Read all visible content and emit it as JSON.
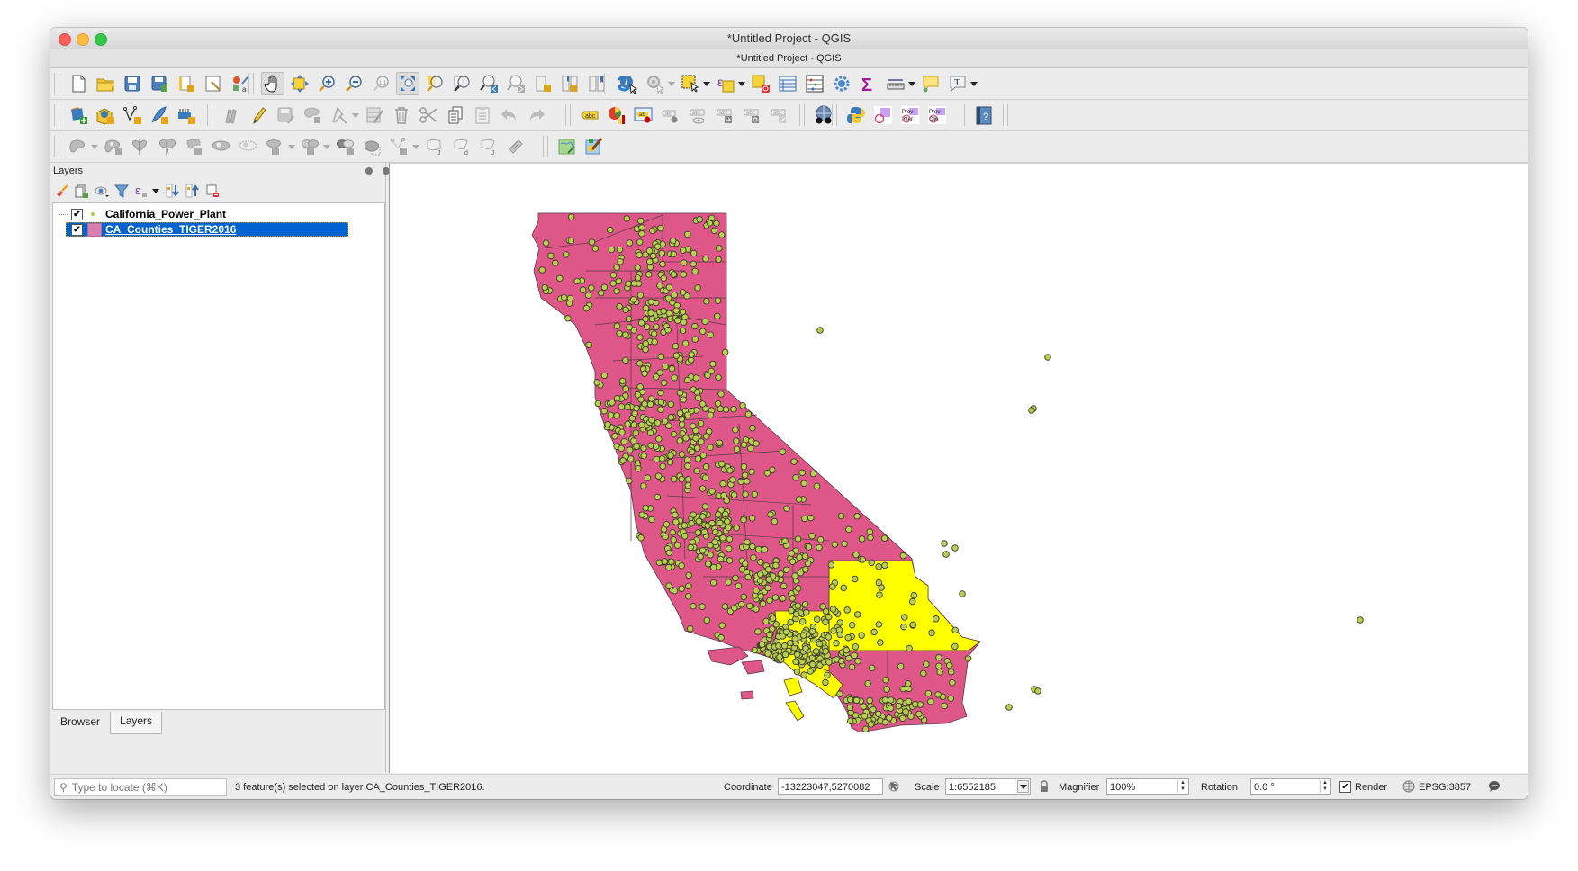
{
  "window": {
    "title": "*Untitled Project - QGIS",
    "subtitle": "*Untitled Project - QGIS"
  },
  "toolbars": {
    "row1": [
      {
        "name": "new-project",
        "icon": "new-file-icon"
      },
      {
        "name": "open-project",
        "icon": "folder-icon"
      },
      {
        "name": "save-project",
        "icon": "save-icon"
      },
      {
        "name": "save-as",
        "icon": "save-as-icon"
      },
      {
        "name": "new-print-layout",
        "icon": "print-layout-icon"
      },
      {
        "name": "layout-manager",
        "icon": "layout-manager-icon"
      },
      {
        "name": "style-manager",
        "icon": "style-manager-icon"
      },
      {
        "name": "pan-map",
        "icon": "hand-icon",
        "active": true
      },
      {
        "name": "pan-to-selection",
        "icon": "pan-selection-icon"
      },
      {
        "name": "zoom-in",
        "icon": "zoom-in-icon"
      },
      {
        "name": "zoom-out",
        "icon": "zoom-out-icon"
      },
      {
        "name": "zoom-native",
        "icon": "zoom-1-1-icon"
      },
      {
        "name": "zoom-full",
        "icon": "zoom-full-icon"
      },
      {
        "name": "zoom-to-selection",
        "icon": "zoom-selection-icon"
      },
      {
        "name": "zoom-to-layer",
        "icon": "zoom-layer-icon"
      },
      {
        "name": "zoom-last",
        "icon": "zoom-last-icon"
      },
      {
        "name": "zoom-next",
        "icon": "zoom-next-icon"
      },
      {
        "name": "new-bookmark",
        "icon": "new-bookmark-icon"
      },
      {
        "name": "show-bookmarks",
        "icon": "bookmarks-icon"
      },
      {
        "name": "spatial-bookmarks",
        "icon": "bookmark-icon"
      },
      {
        "name": "refresh",
        "icon": "refresh-icon"
      },
      {
        "name": "identify",
        "icon": "identify-icon"
      },
      {
        "name": "run-action",
        "icon": "action-icon"
      },
      {
        "name": "select-features",
        "icon": "select-icon"
      },
      {
        "name": "select-by-expression",
        "icon": "expression-select-icon"
      },
      {
        "name": "deselect-all",
        "icon": "deselect-icon"
      },
      {
        "name": "attribute-table",
        "icon": "table-icon"
      },
      {
        "name": "field-calculator",
        "icon": "abacus-icon"
      },
      {
        "name": "processing-toolbox",
        "icon": "gear-icon"
      },
      {
        "name": "statistical-summary",
        "icon": "sigma-icon"
      },
      {
        "name": "measure-line",
        "icon": "ruler-icon"
      },
      {
        "name": "map-tips",
        "icon": "speech-bubble-icon"
      },
      {
        "name": "text-annotation",
        "icon": "text-annotation-icon"
      }
    ],
    "row2": [
      {
        "name": "data-source-manager",
        "icon": "add-layer-icon"
      },
      {
        "name": "new-geopackage-layer",
        "icon": "geopackage-icon"
      },
      {
        "name": "new-shapefile-layer",
        "icon": "shapefile-icon"
      },
      {
        "name": "new-spatialite-layer",
        "icon": "feather-icon"
      },
      {
        "name": "new-virtual-layer",
        "icon": "virtual-layer-icon"
      },
      {
        "name": "current-edits",
        "icon": "edits-icon"
      },
      {
        "name": "toggle-editing",
        "icon": "pencil-icon"
      },
      {
        "name": "save-layer-edits",
        "icon": "save-edits-icon"
      },
      {
        "name": "add-feature",
        "icon": "add-polygon-icon"
      },
      {
        "name": "vertex-tool",
        "icon": "vertex-tool-icon"
      },
      {
        "name": "modify-attributes",
        "icon": "modify-attributes-icon"
      },
      {
        "name": "delete-selected",
        "icon": "trash-icon"
      },
      {
        "name": "cut-features",
        "icon": "scissors-icon"
      },
      {
        "name": "copy-features",
        "icon": "copy-icon"
      },
      {
        "name": "paste-features",
        "icon": "paste-icon"
      },
      {
        "name": "undo",
        "icon": "undo-icon"
      },
      {
        "name": "redo",
        "icon": "redo-icon"
      },
      {
        "name": "layer-labeling",
        "icon": "label-icon"
      },
      {
        "name": "layer-diagram",
        "icon": "diagram-icon"
      },
      {
        "name": "pin-labels",
        "icon": "pin-label-icon"
      },
      {
        "name": "highlight-pinned",
        "icon": "highlight-label-icon"
      },
      {
        "name": "show-hide-labels",
        "icon": "show-label-icon"
      },
      {
        "name": "move-label",
        "icon": "move-label-icon"
      },
      {
        "name": "rotate-label",
        "icon": "rotate-label-icon"
      },
      {
        "name": "change-label",
        "icon": "change-label-icon"
      },
      {
        "name": "geocoding",
        "icon": "globe-binoculars-icon"
      },
      {
        "name": "python-console",
        "icon": "python-icon"
      },
      {
        "name": "plugin-a",
        "icon": "plugin-shape-icon"
      },
      {
        "name": "prev-inter",
        "icon": "prev-inter-icon",
        "label": "Prev Inter"
      },
      {
        "name": "prev-clip",
        "icon": "prev-clip-icon",
        "label": "Prev Clip"
      },
      {
        "name": "help",
        "icon": "help-book-icon"
      }
    ],
    "row3": [
      {
        "name": "digitize-shape",
        "icon": "shape-icon"
      },
      {
        "name": "add-ring",
        "icon": "ring-icon"
      },
      {
        "name": "split-features",
        "icon": "split-icon"
      },
      {
        "name": "reshape",
        "icon": "reshape-icon"
      },
      {
        "name": "offset-curve",
        "icon": "offset-icon"
      },
      {
        "name": "fill-ring",
        "icon": "fill-ring-icon"
      },
      {
        "name": "delete-ring",
        "icon": "delete-ring-icon"
      },
      {
        "name": "delete-part",
        "icon": "delete-part-icon"
      },
      {
        "name": "merge-features",
        "icon": "merge-icon"
      },
      {
        "name": "merge-attributes",
        "icon": "merge-attributes-icon"
      },
      {
        "name": "rotate-point-symbols",
        "icon": "rotate-icon"
      },
      {
        "name": "simplify",
        "icon": "simplify-icon"
      },
      {
        "name": "trim-extend",
        "icon": "trim-icon"
      },
      {
        "name": "add-part",
        "icon": "add-part-icon"
      },
      {
        "name": "split-parts",
        "icon": "split-parts-icon"
      },
      {
        "name": "reverse-line",
        "icon": "reverse-line-icon"
      },
      {
        "name": "georeferencer",
        "icon": "georeferencer-icon"
      },
      {
        "name": "layout-designer",
        "icon": "paint-map-icon"
      }
    ]
  },
  "layers_panel": {
    "title": "Layers",
    "tools": [
      {
        "name": "open-styling",
        "icon": "paintbrush-icon"
      },
      {
        "name": "add-group",
        "icon": "add-group-icon"
      },
      {
        "name": "manage-visibility",
        "icon": "eye-icon"
      },
      {
        "name": "filter-legend",
        "icon": "filter-icon"
      },
      {
        "name": "filter-by-expression",
        "icon": "expression-icon"
      },
      {
        "name": "expand-all",
        "icon": "expand-icon"
      },
      {
        "name": "collapse-all",
        "icon": "collapse-icon"
      },
      {
        "name": "remove-layer",
        "icon": "remove-layer-icon"
      }
    ],
    "layers": [
      {
        "name": "California_Power_Plant",
        "checked": true,
        "symbol": "point",
        "symbol_color": "#a9c94a",
        "selected": false
      },
      {
        "name": "CA_Counties_TIGER2016",
        "checked": true,
        "symbol": "polygon",
        "symbol_color": "#d97faf",
        "selected": true
      }
    ],
    "tabs": [
      {
        "label": "Browser",
        "active": false
      },
      {
        "label": "Layers",
        "active": true
      }
    ]
  },
  "map": {
    "layers": [
      "CA_Counties_TIGER2016",
      "California_Power_Plant"
    ],
    "county_fill": "#de5788",
    "selected_fill": "#ffff00",
    "point_fill": "#b9cf4f",
    "point_stroke": "#3b3b2a",
    "selected_counties_count": 3
  },
  "status": {
    "locate_placeholder": "Type to locate (⌘K)",
    "message": "3 feature(s) selected on layer CA_Counties_TIGER2016.",
    "coordinate_label": "Coordinate",
    "coordinate_value": "-13223047,5270082",
    "scale_label": "Scale",
    "scale_value": "1:6552185",
    "magnifier_label": "Magnifier",
    "magnifier_value": "100%",
    "rotation_label": "Rotation",
    "rotation_value": "0.0 °",
    "render_label": "Render",
    "render_checked": true,
    "crs": "EPSG:3857"
  }
}
